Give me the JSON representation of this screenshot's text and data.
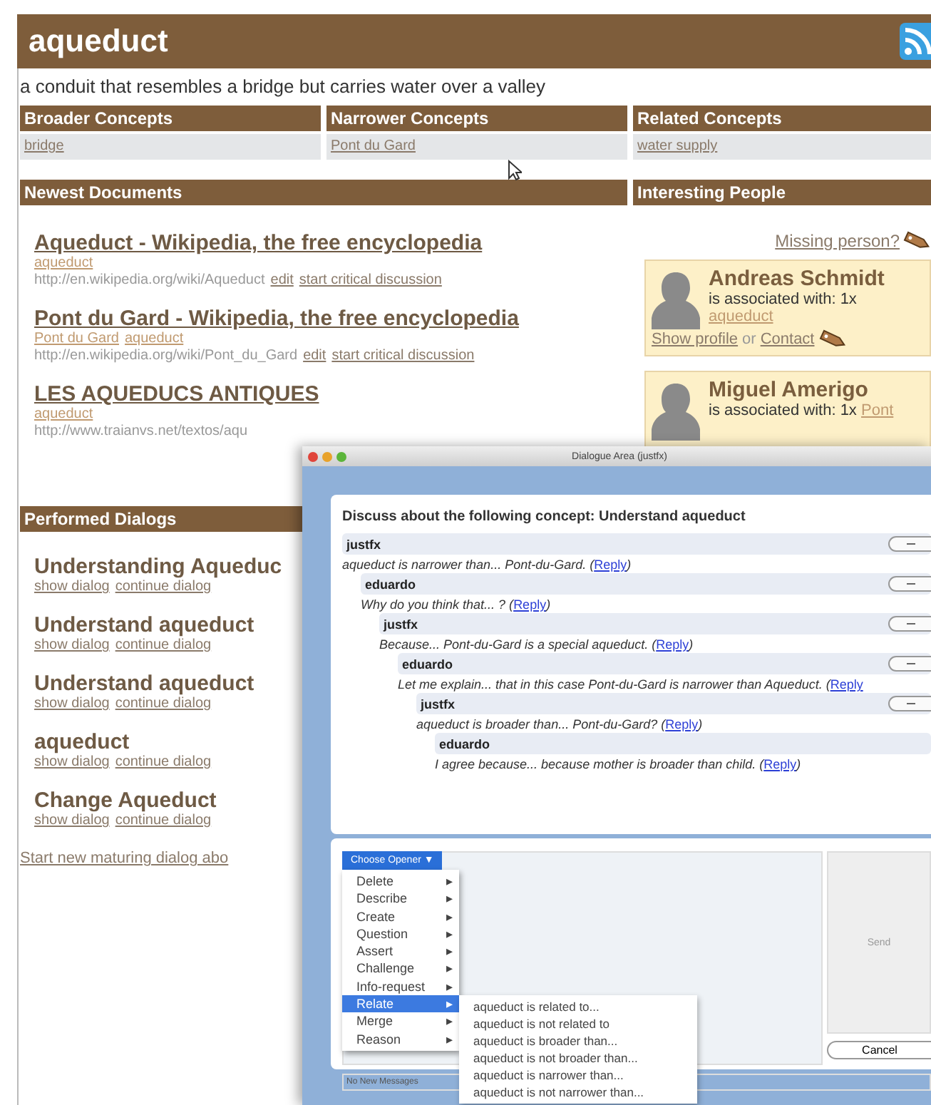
{
  "page": {
    "title": "aqueduct",
    "description": "a conduit that resembles a bridge but carries water over a valley"
  },
  "concepts": [
    {
      "heading": "Broader Concepts",
      "links": [
        "bridge"
      ]
    },
    {
      "heading": "Narrower Concepts",
      "links": [
        "Pont du Gard"
      ]
    },
    {
      "heading": "Related Concepts",
      "links": [
        "water supply"
      ]
    }
  ],
  "newest_documents": {
    "heading": "Newest Documents",
    "items": [
      {
        "title": "Aqueduct - Wikipedia, the free encyclopedia",
        "tags": [
          "aqueduct"
        ],
        "url": "http://en.wikipedia.org/wiki/Aqueduct",
        "actions": [
          "edit",
          "start critical discussion"
        ]
      },
      {
        "title": "Pont du Gard - Wikipedia, the free encyclopedia",
        "tags": [
          "Pont du Gard",
          "aqueduct"
        ],
        "url": "http://en.wikipedia.org/wiki/Pont_du_Gard",
        "actions": [
          "edit",
          "start critical discussion"
        ]
      },
      {
        "title": "LES AQUEDUCS ANTIQUES",
        "tags": [
          "aqueduct"
        ],
        "url": "http://www.traianvs.net/textos/aqu"
      }
    ]
  },
  "interesting_people": {
    "heading": "Interesting People",
    "missing_link": "Missing person?",
    "people": [
      {
        "name": "Andreas Schmidt",
        "association": "is associated with: 1x",
        "links": [
          "aqueduct"
        ],
        "profile": "Show profile",
        "joiner": "or",
        "contact": "Contact"
      },
      {
        "name": "Miguel Amerigo",
        "association": "is associated with: 1x",
        "links": [
          "Pont"
        ]
      }
    ]
  },
  "performed_dialogs": {
    "heading": "Performed Dialogs",
    "items": [
      {
        "title": "Understanding Aqueduc",
        "actions": [
          "show dialog",
          "continue dialog"
        ]
      },
      {
        "title": "Understand aqueduct",
        "actions": [
          "show dialog",
          "continue dialog"
        ]
      },
      {
        "title": "Understand aqueduct",
        "actions": [
          "show dialog",
          "continue dialog"
        ]
      },
      {
        "title": "aqueduct",
        "actions": [
          "show dialog",
          "continue dialog"
        ]
      },
      {
        "title": "Change Aqueduct",
        "actions": [
          "show dialog",
          "continue dialog"
        ]
      }
    ],
    "start_link": "Start new maturing dialog abo"
  },
  "dialog_window": {
    "title": "Dialogue Area (justfx)",
    "heading": "Discuss about the following concept: Understand aqueduct",
    "thread": [
      {
        "author": "justfx",
        "text": "aqueduct is narrower than... Pont-du-Gard. (",
        "link": "Reply",
        "after": ")",
        "toggle": true,
        "children": [
          {
            "author": "eduardo",
            "text": "Why do you think that... ? (",
            "link": "Reply",
            "after": ")",
            "toggle": true,
            "children": [
              {
                "author": "justfx",
                "text": "Because... Pont-du-Gard is a special aqueduct. (",
                "link": "Reply",
                "after": ")",
                "toggle": true,
                "children": [
                  {
                    "author": "eduardo",
                    "text": "Let me explain... that in this case Pont-du-Gard is narrower than Aqueduct. (",
                    "link": "Reply",
                    "toggle": true,
                    "children": [
                      {
                        "author": "justfx",
                        "text": "aqueduct is broader than... Pont-du-Gard? (",
                        "link": "Reply",
                        "after": ")",
                        "toggle": true,
                        "children": [
                          {
                            "author": "eduardo",
                            "text": "I agree because... because mother is broader than child. (",
                            "link": "Reply",
                            "after": ")",
                            "toggle": false
                          }
                        ]
                      }
                    ]
                  }
                ]
              }
            ]
          }
        ]
      }
    ],
    "composer": {
      "opener": "Choose Opener ▼",
      "menu": [
        {
          "label": "Delete",
          "arrow": "▸",
          "selected": false
        },
        {
          "label": "Describe",
          "arrow": "▸",
          "selected": false
        },
        {
          "label": "Create",
          "arrow": "▸",
          "selected": false
        },
        {
          "label": "Question",
          "arrow": "▸",
          "selected": false
        },
        {
          "label": "Assert",
          "arrow": "▸",
          "selected": false
        },
        {
          "label": "Challenge",
          "arrow": "▸",
          "selected": false
        },
        {
          "label": "Info-request",
          "arrow": "▸",
          "selected": false
        },
        {
          "label": "Relate",
          "arrow": "▸",
          "selected": true
        },
        {
          "label": "Merge",
          "arrow": "▸",
          "selected": false
        },
        {
          "label": "Reason",
          "arrow": "▸",
          "selected": false
        }
      ],
      "submenu": [
        "aqueduct is related to...",
        "aqueduct is not related to",
        "aqueduct is broader than...",
        "aqueduct is not broader than...",
        "aqueduct is narrower than...",
        "aqueduct is not narrower than..."
      ],
      "send": "Send",
      "cancel": "Cancel"
    },
    "status": "No New Messages"
  }
}
